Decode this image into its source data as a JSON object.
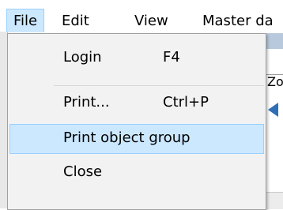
{
  "menubar": {
    "items": [
      {
        "label": "File",
        "active": true
      },
      {
        "label": "Edit"
      },
      {
        "label": "View"
      },
      {
        "label": "Master da"
      }
    ]
  },
  "file_menu": {
    "items": [
      {
        "label": "Login",
        "shortcut": "F4"
      },
      {
        "label": "Print...",
        "shortcut": "Ctrl+P"
      },
      {
        "label": "Print object group",
        "shortcut": "",
        "highlighted": true
      },
      {
        "label": "Close",
        "shortcut": ""
      }
    ]
  },
  "background": {
    "fragment_text": "Zo"
  },
  "colors": {
    "highlight_fill": "#cce8ff",
    "highlight_border": "#99d1ff",
    "menu_background": "#f2f2f2"
  }
}
